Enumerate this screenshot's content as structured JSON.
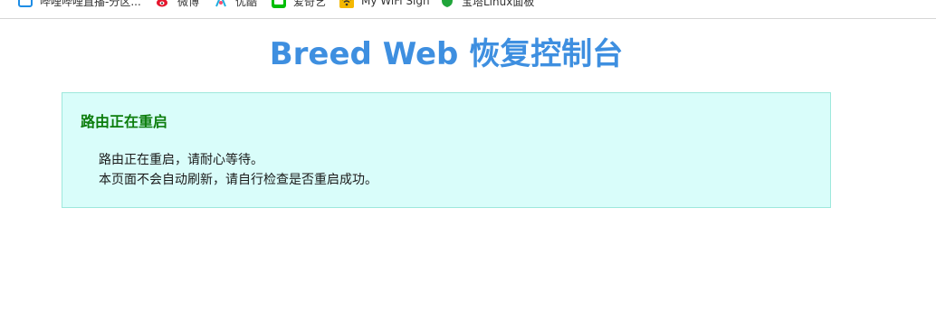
{
  "bookmarks": [
    {
      "label": "哔哩哔哩直播-分区...",
      "icon": "bilibili-tv-icon",
      "color": "#1e8de6"
    },
    {
      "label": "微博",
      "icon": "weibo-icon",
      "color": "#e6162d"
    },
    {
      "label": "优酷",
      "icon": "youku-icon",
      "color": "#1faee0"
    },
    {
      "label": "爱奇艺",
      "icon": "iqiyi-icon",
      "color": "#00be06"
    },
    {
      "label": "My WiFi Sign",
      "icon": "wifi-icon",
      "color": "#f5b800"
    },
    {
      "label": "宝塔Linux面板",
      "icon": "shield-icon",
      "color": "#20a53a"
    }
  ],
  "page": {
    "title": "Breed Web 恢复控制台",
    "title_color": "#3e8fe0"
  },
  "message": {
    "heading": "路由正在重启",
    "heading_color": "#0c7d0c",
    "panel_color": "#d9fdfa",
    "panel_border_color": "#9ee8dc",
    "lines": [
      "路由正在重启，请耐心等待。",
      "本页面不会自动刷新，请自行检查是否重启成功。"
    ]
  }
}
